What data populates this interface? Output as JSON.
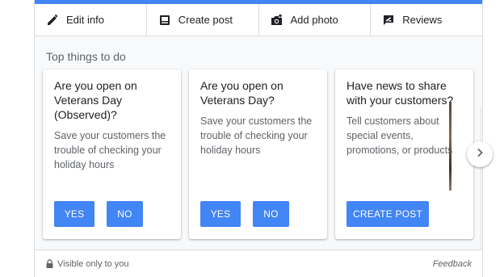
{
  "toolbar": {
    "items": [
      {
        "label": "Edit info",
        "icon": "pencil-icon"
      },
      {
        "label": "Create post",
        "icon": "post-icon"
      },
      {
        "label": "Add photo",
        "icon": "add-photo-icon"
      },
      {
        "label": "Reviews",
        "icon": "reviews-icon"
      }
    ]
  },
  "section": {
    "title": "Top things to do",
    "cards": [
      {
        "title": "Are you open on Veterans Day (Observed)?",
        "text": "Save your customers the trouble of checking your holiday hours",
        "buttons": [
          "YES",
          "NO"
        ]
      },
      {
        "title": "Are you open on Veterans Day?",
        "text": "Save your customers the trouble of checking your holiday hours",
        "buttons": [
          "YES",
          "NO"
        ]
      },
      {
        "title": "Have news to share with your customers?",
        "text": "Tell customers about special events, promotions, or products",
        "buttons": [
          "CREATE POST"
        ]
      }
    ]
  },
  "footer": {
    "visibility": "Visible only to you",
    "feedback": "Feedback"
  },
  "colors": {
    "accent": "#4285f4",
    "text": "#202124",
    "secondary_text": "#5f6368",
    "border": "#dadce0"
  }
}
